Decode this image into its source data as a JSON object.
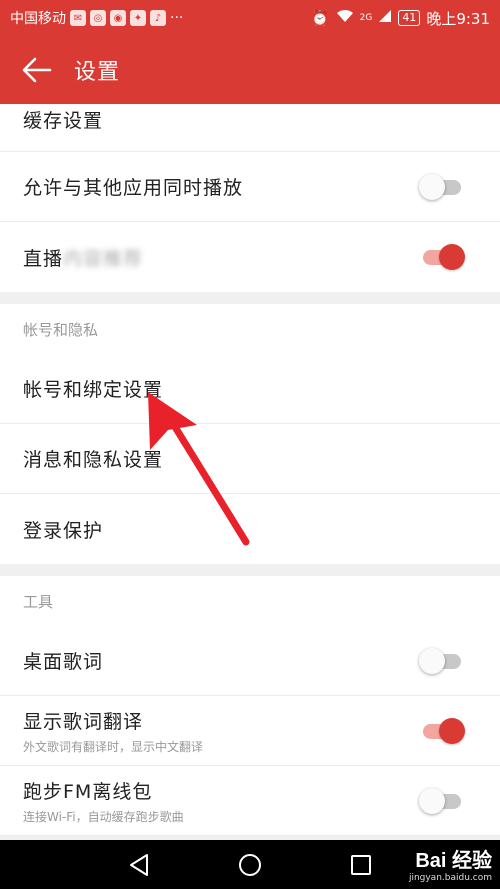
{
  "status_bar": {
    "carrier": "中国移动",
    "icons": [
      "wechat-icon",
      "app-icon",
      "weibo-icon",
      "app-icon",
      "tiktok-icon"
    ],
    "more": "···",
    "network": "2G",
    "battery": "41",
    "time": "晚上9:31"
  },
  "app_bar": {
    "title": "设置"
  },
  "sections": [
    {
      "rows": [
        {
          "label": "缓存设置"
        },
        {
          "label": "允许与其他应用同时播放",
          "toggle": false
        },
        {
          "label": "直播",
          "blurred": "内容推荐",
          "toggle": true
        }
      ]
    },
    {
      "header": "帐号和隐私",
      "rows": [
        {
          "label": "帐号和绑定设置"
        },
        {
          "label": "消息和隐私设置"
        },
        {
          "label": "登录保护"
        }
      ]
    },
    {
      "header": "工具",
      "rows": [
        {
          "label": "桌面歌词",
          "toggle": false
        },
        {
          "label": "显示歌词翻译",
          "sub": "外文歌词有翻译时，显示中文翻译",
          "toggle": true
        },
        {
          "label": "跑步FM离线包",
          "sub": "连接Wi-Fi，自动缓存跑步歌曲",
          "toggle": false
        }
      ]
    }
  ],
  "watermark": {
    "main": "Bai 经验",
    "sub": "jingyan.baidu.com"
  },
  "colors": {
    "accent": "#d93b34",
    "toggle_on_track": "#f3a5a0",
    "toggle_off_track": "#c8c8c8",
    "annotation_arrow": "#e8212b"
  }
}
